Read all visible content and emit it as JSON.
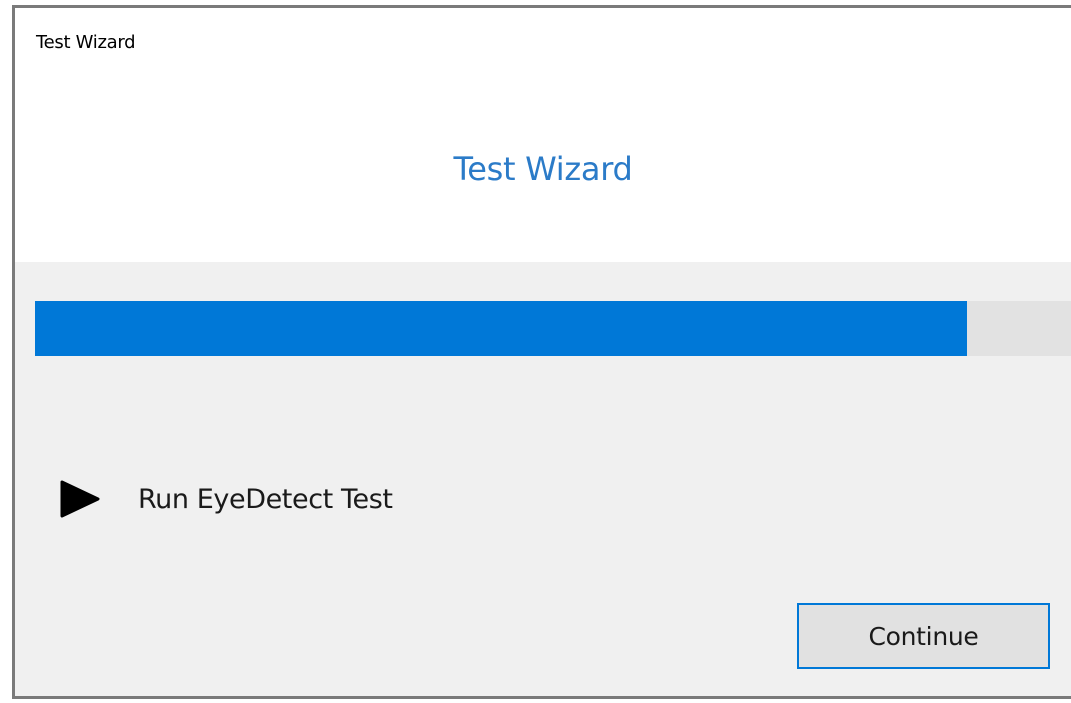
{
  "window": {
    "title": "Test Wizard"
  },
  "header": {
    "title": "Test Wizard",
    "title_color": "#2b7bc8"
  },
  "progress": {
    "value_percent": 90,
    "fill_color": "#0078d7",
    "track_color": "#e2e2e2"
  },
  "step": {
    "icon": "play-icon",
    "label": "Run EyeDetect Test"
  },
  "footer": {
    "continue_label": "Continue"
  }
}
